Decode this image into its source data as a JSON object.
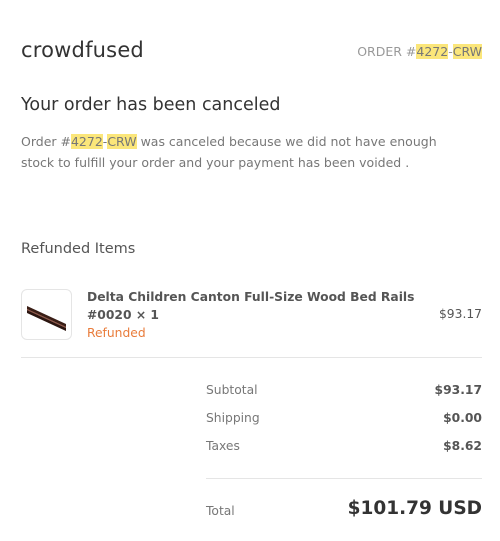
{
  "shop": {
    "name": "crowdfused"
  },
  "order_ref": {
    "prefix": "ORDER #",
    "number": "4272",
    "dash": "-",
    "suffix": "CRW"
  },
  "heading": "Your order has been canceled",
  "message": {
    "before": "Order #",
    "number": "4272",
    "dash": "-",
    "suffix": "CRW",
    "after": " was canceled because we did not have enough stock to fulfill your order and your payment has been voided ."
  },
  "refunded": {
    "title": "Refunded Items",
    "items": [
      {
        "name": "Delta Children Canton Full-Size Wood Bed Rails #0020",
        "quantity": "× 1",
        "status": "Refunded",
        "price": "$93.17",
        "thumbnail_icon": "bed-rails-icon"
      }
    ]
  },
  "totals": {
    "subtotal_label": "Subtotal",
    "subtotal_value": "$93.17",
    "shipping_label": "Shipping",
    "shipping_value": "$0.00",
    "taxes_label": "Taxes",
    "taxes_value": "$8.62",
    "total_label": "Total",
    "total_value": "$101.79 USD"
  },
  "colors": {
    "highlight": "#fbe67a",
    "refunded_status": "#e97c3b",
    "muted_text": "#777777"
  }
}
